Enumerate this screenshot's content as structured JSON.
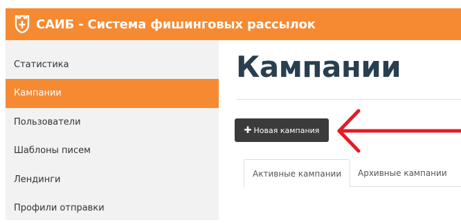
{
  "header": {
    "title": "САИБ - Система фишинговых рассылок",
    "logo_icon": "castle-shield-icon",
    "bg_color": "#f58a32"
  },
  "sidebar": {
    "items": [
      {
        "label": "Статистика",
        "active": false
      },
      {
        "label": "Кампании",
        "active": true
      },
      {
        "label": "Пользователи",
        "active": false
      },
      {
        "label": "Шаблоны писем",
        "active": false
      },
      {
        "label": "Лендинги",
        "active": false
      },
      {
        "label": "Профили отправки",
        "active": false
      }
    ]
  },
  "main": {
    "title": "Кампании",
    "new_button": {
      "icon": "plus-icon",
      "symbol": "✚",
      "label": "Новая кампания"
    },
    "annotation_arrow": {
      "icon": "red-arrow-icon",
      "color": "#e31b23"
    },
    "tabs": [
      {
        "label": "Активные кампании",
        "active": true
      },
      {
        "label": "Архивные кампании",
        "active": false
      }
    ]
  }
}
